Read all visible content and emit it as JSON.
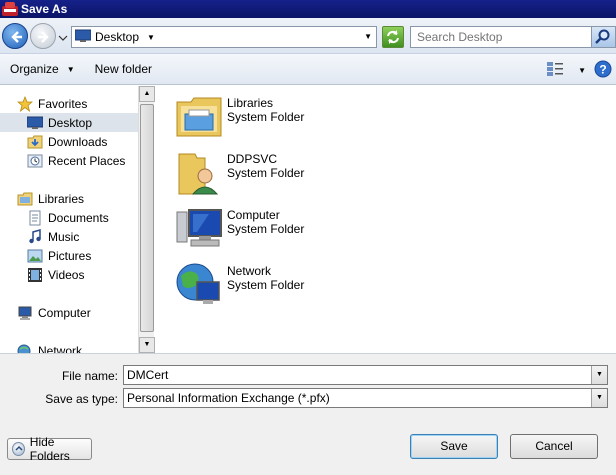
{
  "window": {
    "title": "Save As"
  },
  "address": {
    "location": "Desktop",
    "search_placeholder": "Search Desktop"
  },
  "toolbar": {
    "organize_label": "Organize",
    "new_folder_label": "New folder"
  },
  "nav": {
    "favorites_label": "Favorites",
    "favorites": [
      {
        "label": "Desktop",
        "icon": "desktop-icon",
        "selected": true
      },
      {
        "label": "Downloads",
        "icon": "downloads-icon"
      },
      {
        "label": "Recent Places",
        "icon": "recent-places-icon"
      }
    ],
    "libraries_label": "Libraries",
    "libraries": [
      {
        "label": "Documents",
        "icon": "documents-icon"
      },
      {
        "label": "Music",
        "icon": "music-icon"
      },
      {
        "label": "Pictures",
        "icon": "pictures-icon"
      },
      {
        "label": "Videos",
        "icon": "videos-icon"
      }
    ],
    "computer_label": "Computer",
    "network_label": "Network"
  },
  "items": [
    {
      "name": "Libraries",
      "type": "System Folder",
      "icon": "libraries-folder-icon"
    },
    {
      "name": "DDPSVC",
      "type": "System Folder",
      "icon": "user-folder-icon"
    },
    {
      "name": "Computer",
      "type": "System Folder",
      "icon": "computer-icon"
    },
    {
      "name": "Network",
      "type": "System Folder",
      "icon": "network-icon"
    }
  ],
  "form": {
    "file_name_label": "File name:",
    "file_name_value": "DMCert",
    "save_type_label": "Save as type:",
    "save_type_value": "Personal Information Exchange (*.pfx)"
  },
  "buttons": {
    "hide_folders": "Hide Folders",
    "save": "Save",
    "cancel": "Cancel"
  }
}
